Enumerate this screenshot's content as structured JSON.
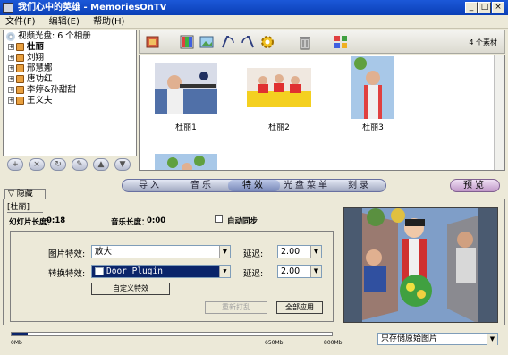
{
  "window": {
    "title": "我们心中的英雄 - MemoriesOnTV",
    "min": "_",
    "max": "□",
    "close": "×"
  },
  "menubar": [
    "文件(F)",
    "编辑(E)",
    "帮助(H)"
  ],
  "tree": {
    "root": "视频光盘: 6 个相册",
    "items": [
      "杜丽",
      "刘翔",
      "邢慧娜",
      "唐功红",
      "李婷&孙甜甜",
      "王义夫"
    ]
  },
  "gallery": {
    "count": "4 个素材",
    "captions": [
      "杜丽1",
      "杜丽2",
      "杜丽3"
    ]
  },
  "tabs": [
    "导入",
    "音乐",
    "特效",
    "光盘菜单",
    "刻录"
  ],
  "active_tab": "特效",
  "preview_label": "预览",
  "hide_tab": "隐藏",
  "album_name": "杜丽",
  "durations": {
    "slide_label": "幻灯片长度：",
    "slide_value": "0:18",
    "music_label": "音乐长度：",
    "music_value": "0:00",
    "autosync_label": "自动同步"
  },
  "effects": {
    "picture_effect_label": "图片特效:",
    "picture_effect_value": "放大",
    "transition_label": "转换特效:",
    "transition_value": "Door Plugin",
    "delay_label_1": "延迟:",
    "delay_value_1": "2.00",
    "delay_label_2": "延迟:",
    "delay_value_2": "2.00",
    "custom_button": "自定义特效",
    "recreate_button": "重新打乱",
    "apply_all_button": "全部应用"
  },
  "capacity": {
    "ticks": [
      "0Mb",
      "650Mb",
      "800Mb"
    ],
    "used_fraction": 0.05
  },
  "bottom_select": "只存储原始图片",
  "colors": {
    "title_blue": "#0a3fb6",
    "tab_active": "#7888b8",
    "preview": "#c098c8"
  }
}
